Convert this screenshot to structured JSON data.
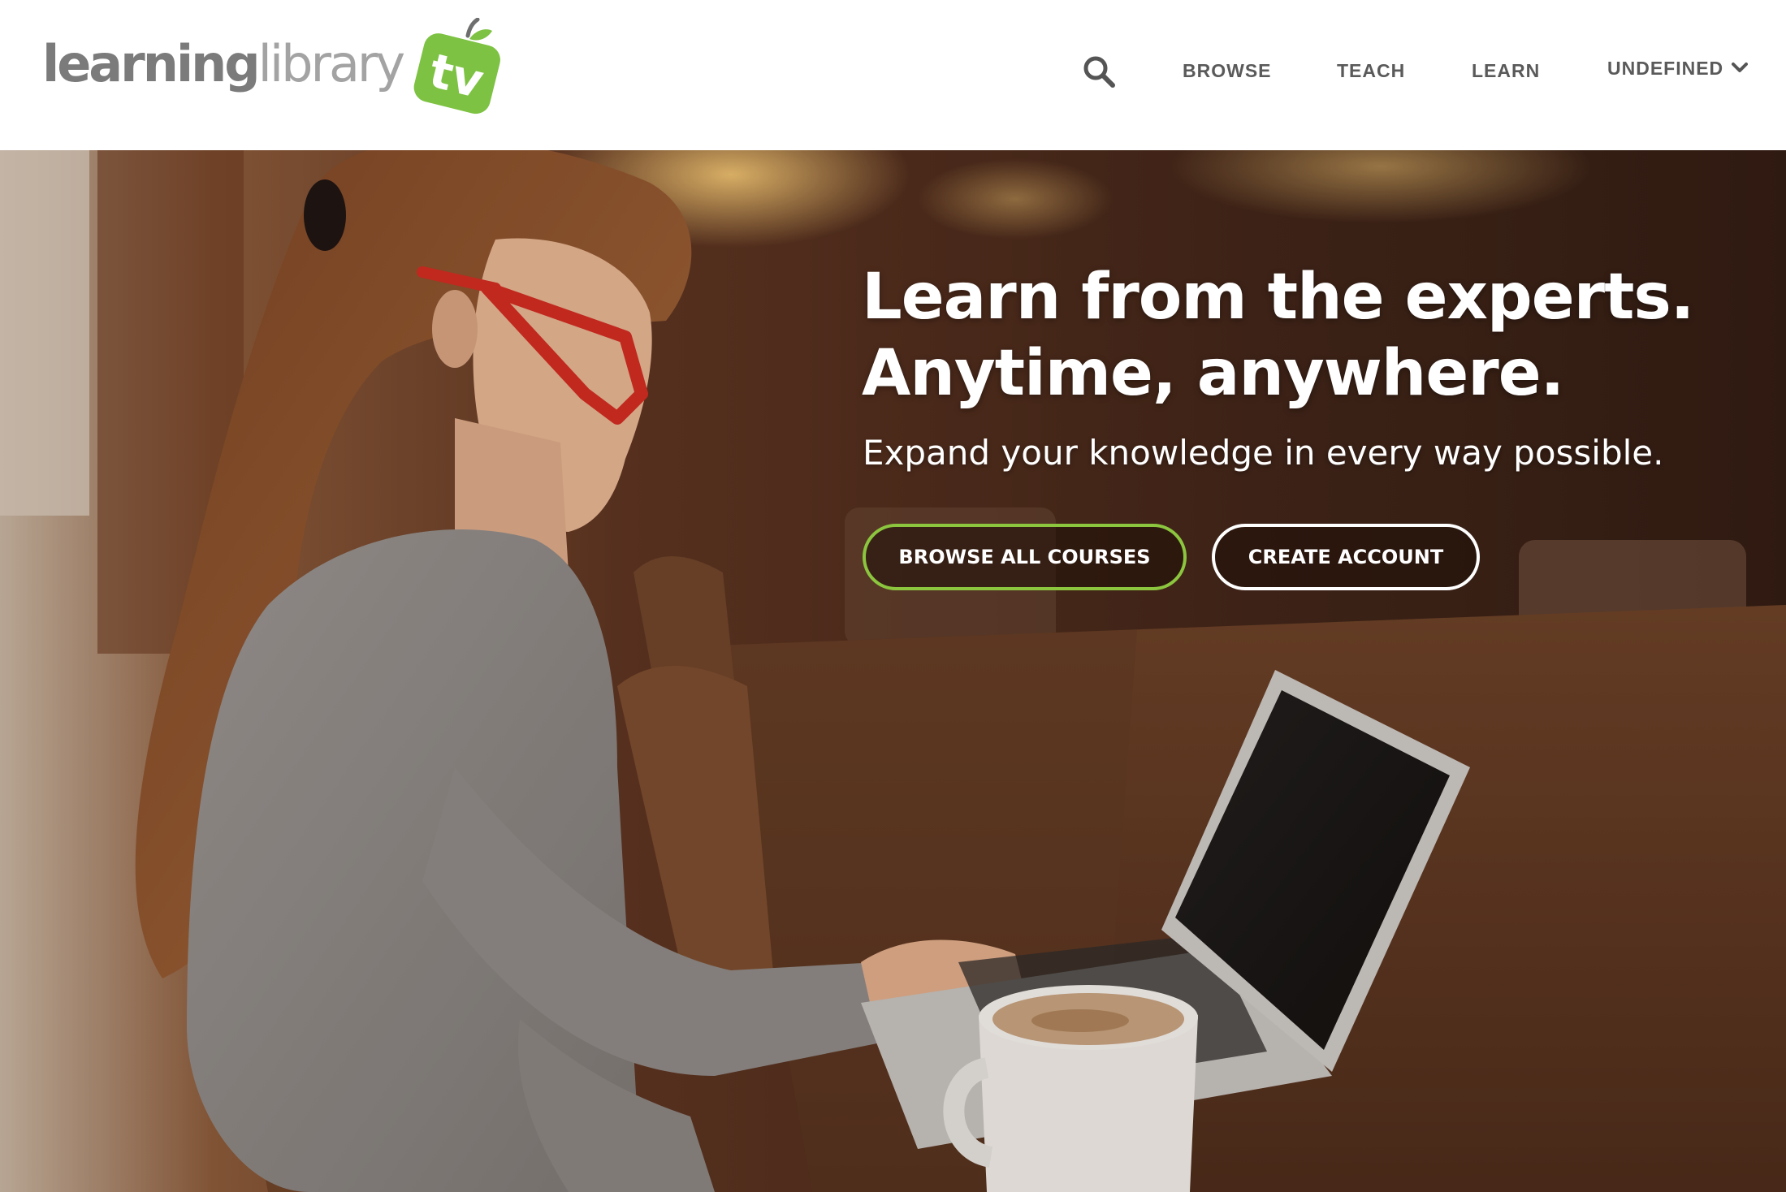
{
  "logo": {
    "word_learning": "learning",
    "word_library": "library",
    "badge_text": "tv",
    "badge_color": "#7dc242"
  },
  "nav": {
    "search_icon": "search-icon",
    "items": [
      {
        "label": "BROWSE"
      },
      {
        "label": "TEACH"
      },
      {
        "label": "LEARN"
      }
    ],
    "user_menu": {
      "label": "UNDEFINED",
      "icon": "chevron-down-icon"
    }
  },
  "hero": {
    "headline_line1": "Learn from the experts.",
    "headline_line2": "Anytime, anywhere.",
    "subheading": "Expand your knowledge in every way possible.",
    "primary_button": "BROWSE ALL COURSES",
    "secondary_button": "CREATE ACCOUNT",
    "background": "photo-woman-with-red-glasses-using-laptop-in-cafe"
  },
  "colors": {
    "accent_green": "#8cc63f",
    "nav_text": "#5a5a5a",
    "logo_gray": "#7b7b7b"
  }
}
